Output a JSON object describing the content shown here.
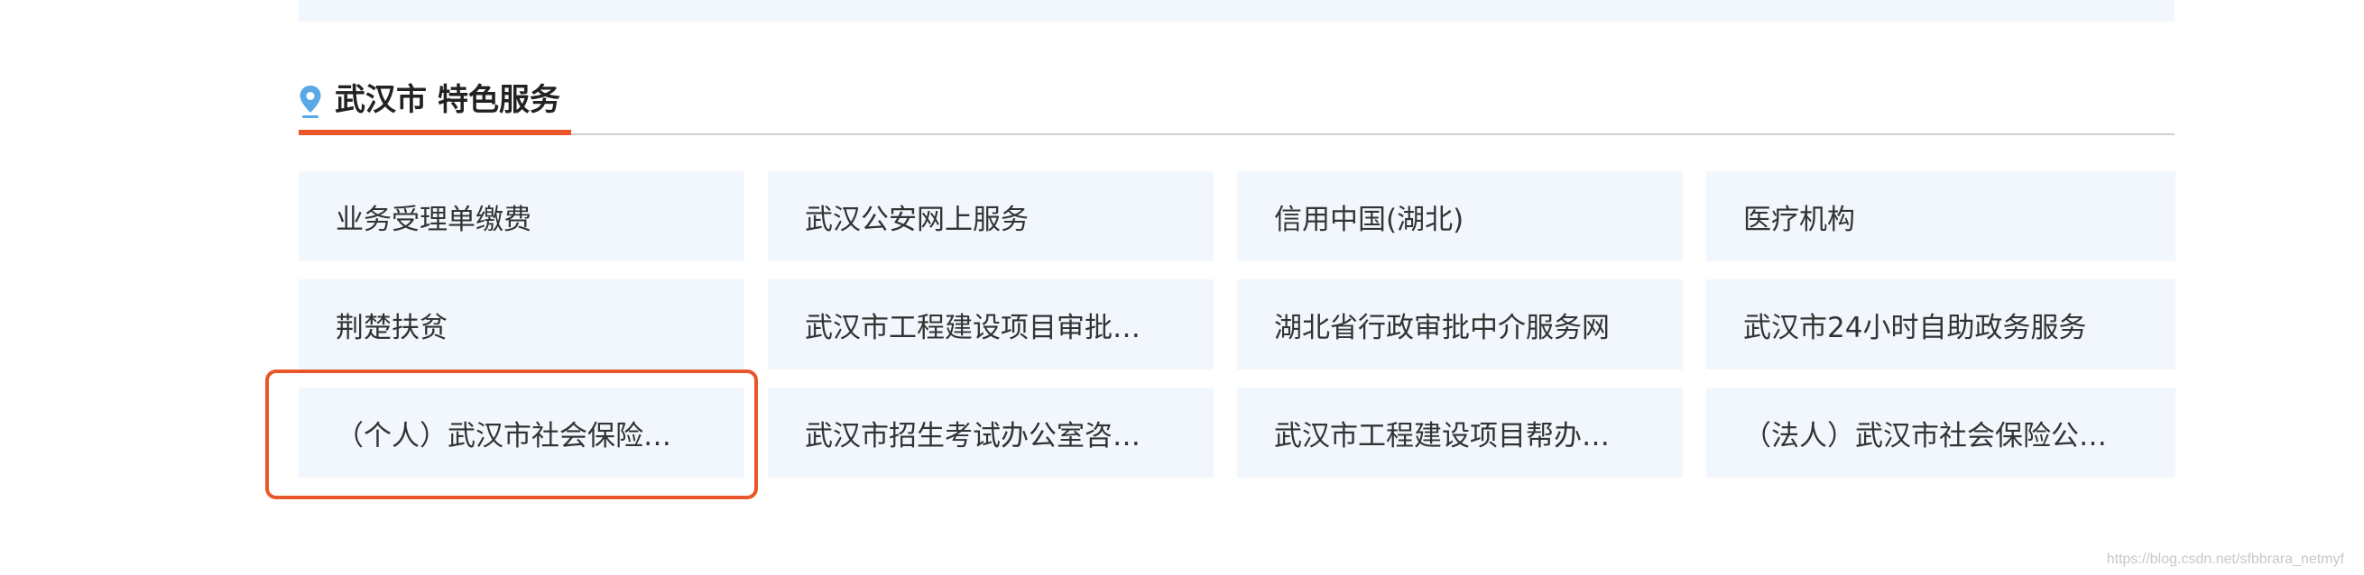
{
  "section": {
    "city": "武汉市",
    "title": "特色服务"
  },
  "services": [
    "业务受理单缴费",
    "武汉公安网上服务",
    "信用中国(湖北)",
    "医疗机构",
    "荆楚扶贫",
    "武汉市工程建设项目审批…",
    "湖北省行政审批中介服务网",
    "武汉市24小时自助政务服务",
    "（个人）武汉市社会保险…",
    "武汉市招生考试办公室咨…",
    "武汉市工程建设项目帮办…",
    "（法人）武汉市社会保险公…"
  ],
  "watermark": "https://blog.csdn.net/sfbbrara_netmyf",
  "colors": {
    "accent": "#e8562a",
    "tile_bg": "#f2f6fd",
    "pin": "#5aa9e6"
  },
  "icons": {
    "pin": "location-pin-icon"
  }
}
